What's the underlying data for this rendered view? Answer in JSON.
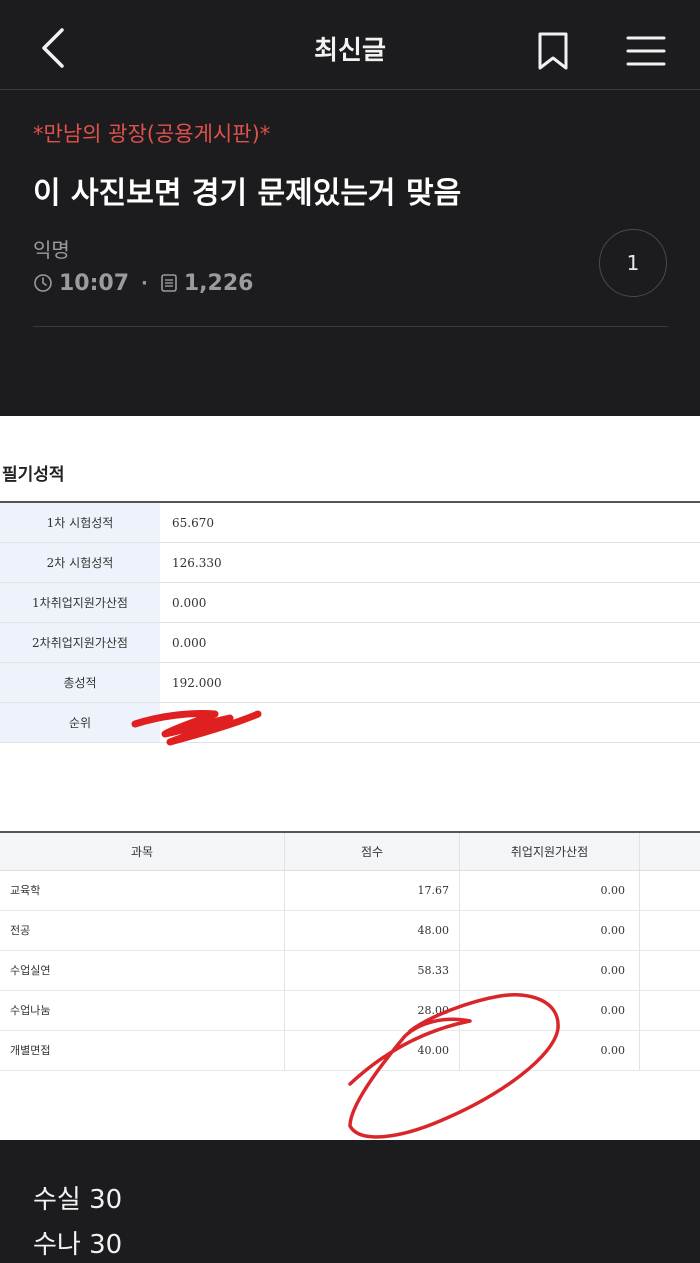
{
  "header": {
    "title": "최신글",
    "back_icon": "chevron-left-icon",
    "bookmark_icon": "bookmark-icon",
    "menu_icon": "hamburger-menu-icon"
  },
  "post": {
    "board": "*만남의 광장(공용게시판)*",
    "title": "이 사진보면 경기 문제있는거 맞음",
    "author": "익명",
    "time": "10:07",
    "views": "1,226",
    "comment_count": "1"
  },
  "image": {
    "heading": "필기성적",
    "scores": [
      {
        "label": "1차 시험성적",
        "value": "65.670"
      },
      {
        "label": "2차 시험성적",
        "value": "126.330"
      },
      {
        "label": "1차취업지원가산점",
        "value": "0.000"
      },
      {
        "label": "2차취업지원가산점",
        "value": "0.000"
      },
      {
        "label": "총성적",
        "value": "192.000"
      },
      {
        "label": "순위",
        "value": ""
      }
    ],
    "subjects_header": {
      "subject": "과목",
      "score": "점수",
      "bonus": "취업지원가산점"
    },
    "subjects": [
      {
        "subject": "교육학",
        "score": "17.67",
        "bonus": "0.00"
      },
      {
        "subject": "전공",
        "score": "48.00",
        "bonus": "0.00"
      },
      {
        "subject": "수업실연",
        "score": "58.33",
        "bonus": "0.00"
      },
      {
        "subject": "수업나눔",
        "score": "28.00",
        "bonus": "0.00"
      },
      {
        "subject": "개별면접",
        "score": "40.00",
        "bonus": "0.00"
      }
    ]
  },
  "body": {
    "lines": [
      "수실 30",
      "수나 30"
    ]
  },
  "colors": {
    "background": "#1c1c1e",
    "board_red": "#e0504d",
    "scribble_red": "#e02020"
  }
}
